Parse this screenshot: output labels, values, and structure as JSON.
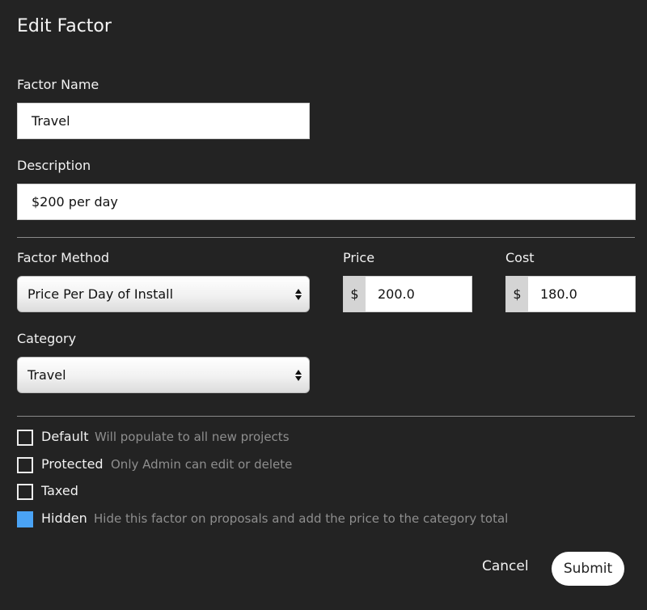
{
  "dialog": {
    "title": "Edit Factor"
  },
  "factor_name": {
    "label": "Factor Name",
    "value": "Travel"
  },
  "description": {
    "label": "Description",
    "value": "$200 per day"
  },
  "factor_method": {
    "label": "Factor Method",
    "selected": "Price Per Day of Install"
  },
  "price": {
    "label": "Price",
    "currency": "$",
    "value": "200.0"
  },
  "cost": {
    "label": "Cost",
    "currency": "$",
    "value": "180.0"
  },
  "category": {
    "label": "Category",
    "selected": "Travel"
  },
  "options": [
    {
      "label": "Default",
      "hint": "Will populate to all new projects",
      "checked": false
    },
    {
      "label": "Protected",
      "hint": "Only Admin can edit or delete",
      "checked": false
    },
    {
      "label": "Taxed",
      "hint": "",
      "checked": false
    },
    {
      "label": "Hidden",
      "hint": "Hide this factor on proposals and add the price to the category total",
      "checked": true
    }
  ],
  "actions": {
    "cancel_label": "Cancel",
    "submit_label": "Submit"
  },
  "colors": {
    "background": "#232323",
    "accent": "#4aa3f5"
  }
}
